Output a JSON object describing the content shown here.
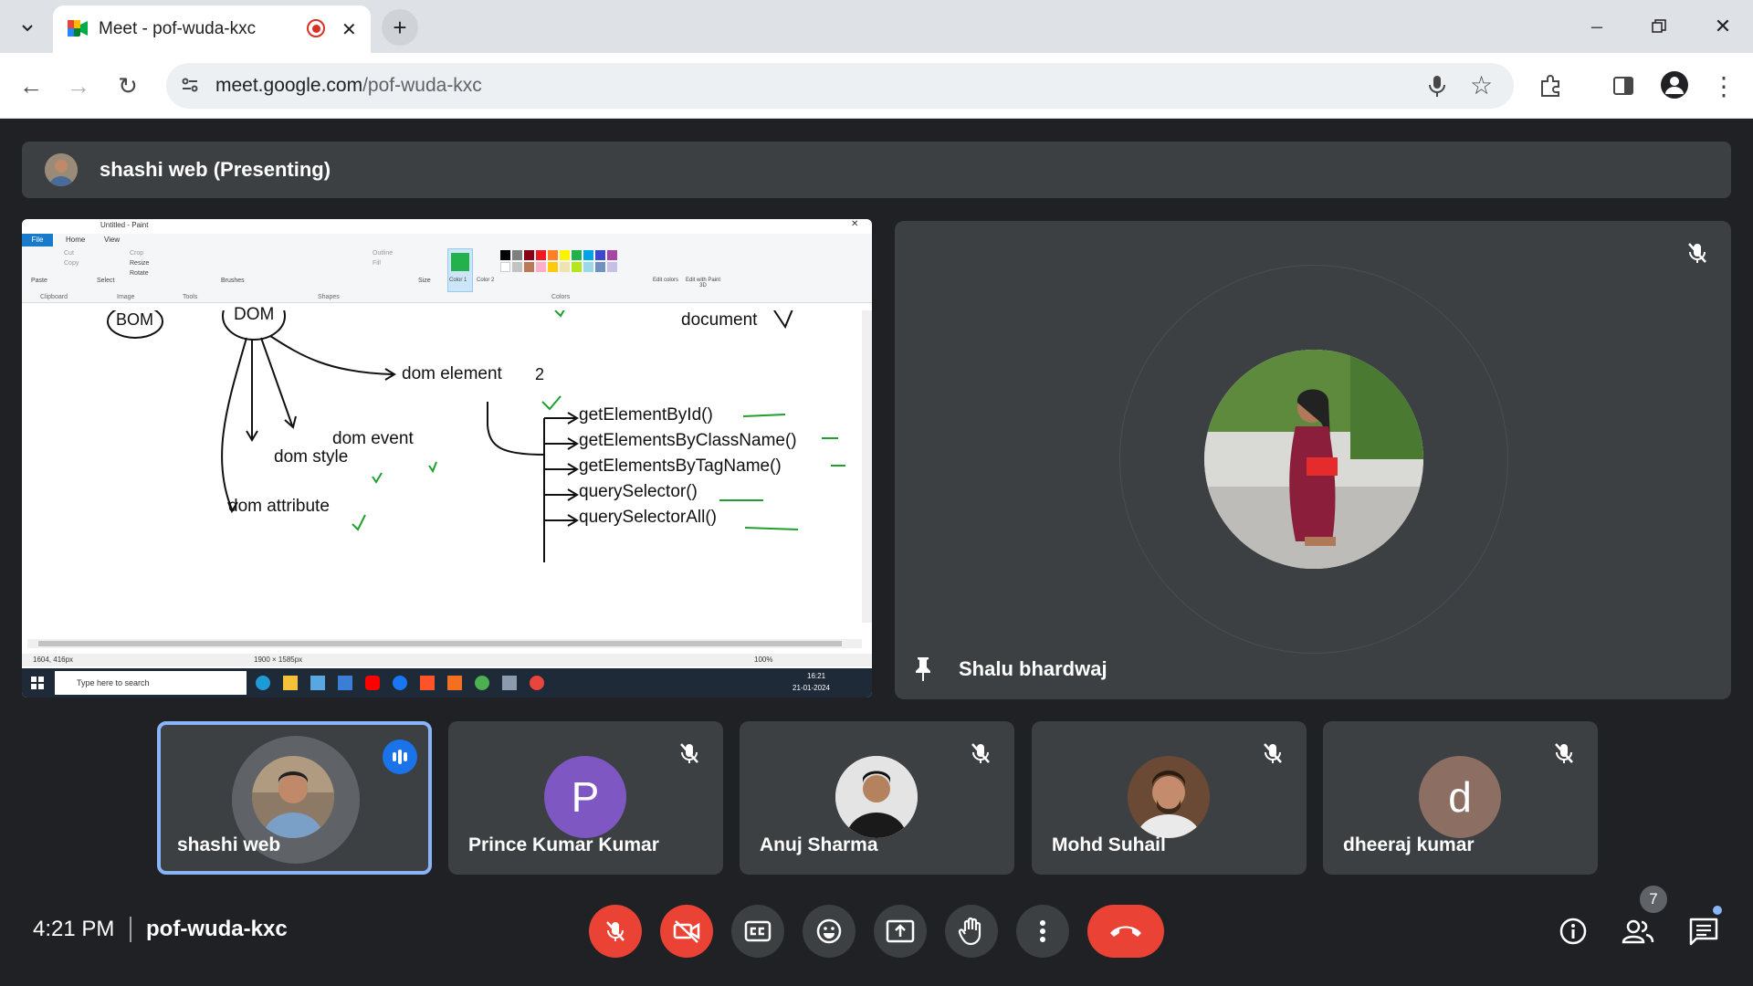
{
  "browser": {
    "tab_title": "Meet - pof-wuda-kxc",
    "url_host": "meet.google.com",
    "url_path": "/pof-wuda-kxc"
  },
  "presenting": {
    "label": "shashi web (Presenting)"
  },
  "shared_screen": {
    "app_title": "Untitled - Paint",
    "menu": [
      "File",
      "Home",
      "View"
    ],
    "ribbon_groups": [
      "Clipboard",
      "Image",
      "Tools",
      "Shapes",
      "Colors"
    ],
    "ribbon_items": [
      "Paste",
      "Cut",
      "Copy",
      "Crop",
      "Resize",
      "Rotate",
      "Select",
      "Brushes",
      "Outline",
      "Fill",
      "Size",
      "Color 1",
      "Color 2",
      "Edit colors",
      "Edit with Paint 3D"
    ],
    "canvas": {
      "bom": "BOM",
      "dom": "DOM",
      "document": "document",
      "dom_element": "dom element",
      "two": "2",
      "dom_event": "dom event",
      "dom_style": "dom style",
      "dom_attribute": "dom attribute",
      "methods": [
        "getElementById()",
        "getElementsByClassName()",
        "getElementsByTagName()",
        "querySelector()",
        "querySelectorAll()"
      ]
    },
    "status": {
      "cursor": "1604, 416px",
      "size": "1900 × 1585px",
      "zoom": "100%"
    },
    "taskbar": {
      "search": "Type here to search",
      "time": "16:21",
      "date": "21-01-2024"
    }
  },
  "main_tile": {
    "name": "Shalu bhardwaj"
  },
  "participants": [
    {
      "name": "shashi web",
      "initial": "",
      "color": "#8a7a6a",
      "speaking": true
    },
    {
      "name": "Prince Kumar Kumar",
      "initial": "P",
      "color": "#7e57c2",
      "speaking": false
    },
    {
      "name": "Anuj Sharma",
      "initial": "",
      "color": "#d8d8d8",
      "speaking": false
    },
    {
      "name": "Mohd Suhail",
      "initial": "",
      "color": "#5a4030",
      "speaking": false
    },
    {
      "name": "dheeraj kumar",
      "initial": "d",
      "color": "#8d6e63",
      "speaking": false
    }
  ],
  "footer": {
    "time": "4:21 PM",
    "meeting_code": "pof-wuda-kxc",
    "people_count": "7"
  },
  "colors": {
    "end_call": "#ea4335",
    "accent": "#8ab4f8"
  }
}
